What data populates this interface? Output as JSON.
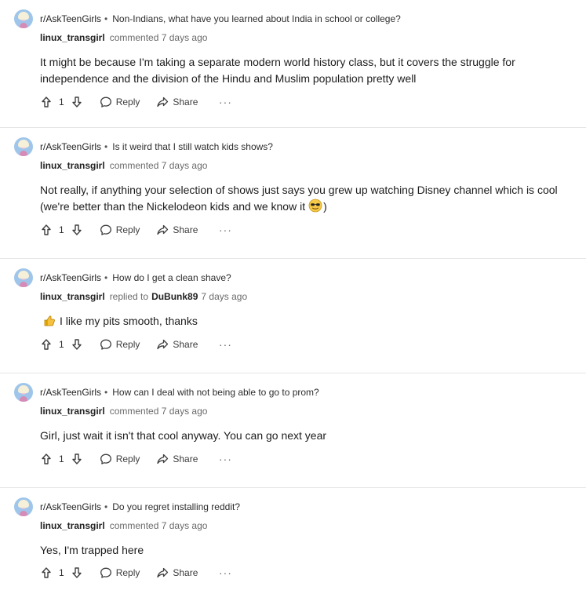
{
  "comments": [
    {
      "subreddit": "r/AskTeenGirls",
      "post_title": "Non-Indians, what have you learned about India in school or college?",
      "author": "linux_transgirl",
      "action": "commented",
      "time": "7 days ago",
      "text": "It might be because I'm taking a separate modern world history class, but it covers the struggle for independence and the division of the Hindu and Muslim population pretty well",
      "votes": "1",
      "reply_label": "Reply",
      "share_label": "Share",
      "more_label": "···"
    },
    {
      "subreddit": "r/AskTeenGirls",
      "post_title": "Is it weird that I still watch kids shows?",
      "author": "linux_transgirl",
      "action": "commented",
      "time": "7 days ago",
      "text_before_emoji": "Not really, if anything your selection of shows just says you grew up watching Disney channel which is cool (we're better than the Nickelodeon kids and we know it",
      "text_after_emoji": ")",
      "emoji": "sunglasses-face-icon",
      "votes": "1",
      "reply_label": "Reply",
      "share_label": "Share",
      "more_label": "···"
    },
    {
      "subreddit": "r/AskTeenGirls",
      "post_title": "How do I get a clean shave?",
      "author": "linux_transgirl",
      "action": "replied to",
      "reply_to": "DuBunk89",
      "time": "7 days ago",
      "text": "I like my pits smooth, thanks",
      "emoji": "thumbs-up-icon",
      "votes": "1",
      "reply_label": "Reply",
      "share_label": "Share",
      "more_label": "···"
    },
    {
      "subreddit": "r/AskTeenGirls",
      "post_title": "How can I deal with not being able to go to prom?",
      "author": "linux_transgirl",
      "action": "commented",
      "time": "7 days ago",
      "text": "Girl, just wait it isn't that cool anyway. You can go next year",
      "votes": "1",
      "reply_label": "Reply",
      "share_label": "Share",
      "more_label": "···"
    },
    {
      "subreddit": "r/AskTeenGirls",
      "post_title": "Do you regret installing reddit?",
      "author": "linux_transgirl",
      "action": "commented",
      "time": "7 days ago",
      "text": "Yes, I'm trapped here",
      "votes": "1",
      "reply_label": "Reply",
      "share_label": "Share",
      "more_label": "···"
    }
  ]
}
